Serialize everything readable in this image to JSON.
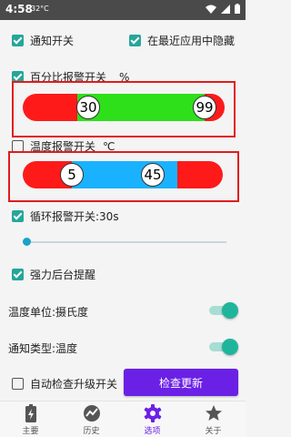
{
  "status_bar": {
    "time": "4:58",
    "temperature": "32°C"
  },
  "settings": {
    "notify_switch": {
      "label": "通知开关",
      "checked": true
    },
    "hide_recent": {
      "label": "在最近应用中隐藏",
      "checked": true
    },
    "percent_alarm": {
      "label": "百分比报警开关",
      "unit": "%",
      "checked": true,
      "low": "30",
      "high": "99",
      "colors": {
        "low": "#ff1a1a",
        "mid": "#2ee01a",
        "high": "#ff1a1a"
      }
    },
    "temp_alarm": {
      "label": "温度报警开关",
      "unit": "℃",
      "checked": false,
      "low": "5",
      "high": "45",
      "colors": {
        "low": "#ff1a1a",
        "mid": "#1ab2ff",
        "high": "#ff1a1a"
      }
    },
    "loop_alarm": {
      "label": "循环报警开关:30s",
      "checked": true,
      "slider_fraction": 0.02
    },
    "strong_reminder": {
      "label": "强力后台提醒",
      "checked": true
    },
    "temp_unit": {
      "label": "温度单位:摄氏度",
      "on": true
    },
    "notify_type": {
      "label": "通知类型:温度",
      "on": true
    },
    "auto_update": {
      "label": "自动检查升级开关",
      "checked": false
    },
    "check_update_button": "检查更新"
  },
  "accent_color": "#6b20e6",
  "highlight_box_color": "#e11c1c",
  "nav": [
    {
      "label": "主要",
      "icon": "battery-icon",
      "active": false
    },
    {
      "label": "历史",
      "icon": "chart-icon",
      "active": false
    },
    {
      "label": "选项",
      "icon": "gear-icon",
      "active": true
    },
    {
      "label": "关于",
      "icon": "star-icon",
      "active": false
    }
  ]
}
